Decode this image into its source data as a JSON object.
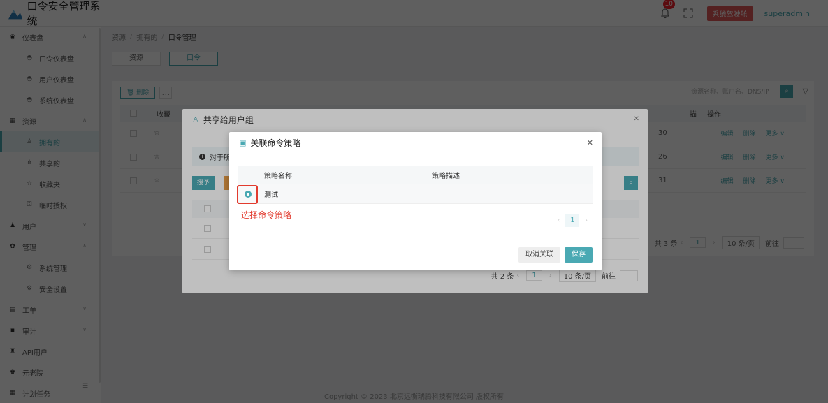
{
  "app": {
    "title": "口令安全管理系统"
  },
  "header": {
    "notification_count": "10",
    "system_button": "系统驾驶舱",
    "user_name": "superadmin"
  },
  "sidebar": {
    "groups": [
      {
        "label": "仪表盘",
        "icon": "dashboard-icon"
      },
      {
        "label": "资源",
        "icon": "grid-icon"
      },
      {
        "label": "用户",
        "icon": "user-icon"
      },
      {
        "label": "管理",
        "icon": "gear-icon"
      },
      {
        "label": "工单",
        "icon": "ticket-icon"
      },
      {
        "label": "审计",
        "icon": "audit-icon"
      },
      {
        "label": "API用户",
        "icon": "api-icon"
      },
      {
        "label": "元老院",
        "icon": "crown-icon"
      },
      {
        "label": "计划任务",
        "icon": "calendar-icon"
      }
    ],
    "subitems": {
      "dashboard": [
        "口令仪表盘",
        "用户仪表盘",
        "系统仪表盘"
      ],
      "resource": [
        "拥有的",
        "共享的",
        "收藏夹",
        "临时授权"
      ],
      "manage": [
        "系统管理",
        "安全设置"
      ]
    }
  },
  "breadcrumb": [
    "资源",
    "拥有的",
    "口令管理"
  ],
  "tabs": [
    "资源",
    "口令"
  ],
  "main": {
    "delete_label": "删除",
    "search_placeholder": "资源名称、账户名、DNS/IP",
    "columns": [
      "收藏",
      "操作"
    ],
    "col_partial": "描",
    "row_values": [
      "30",
      "26",
      "31"
    ],
    "ops": [
      "编辑",
      "删除",
      "更多 ∨"
    ],
    "pager": {
      "total": "共 3 条",
      "page": "1",
      "size": "10 条/页",
      "goto": "前往"
    }
  },
  "share_dialog": {
    "title": "共享给用户组",
    "info_text": "对于所",
    "grant_label": "授予",
    "pager": {
      "total": "共 2 条",
      "page": "1",
      "size": "10 条/页",
      "goto": "前往"
    }
  },
  "policy_dialog": {
    "title": "关联命令策略",
    "columns": [
      "策略名称",
      "策略描述"
    ],
    "rows": [
      {
        "name": "测试",
        "desc": ""
      }
    ],
    "annotation": "选择命令策略",
    "page": "1",
    "cancel_label": "取消关联",
    "save_label": "保存"
  },
  "footer": {
    "copyright": "Copyright © 2023 北京远衡瑞腾科技有限公司 版权所有"
  },
  "colors": {
    "accent": "#4aa9b3",
    "highlight": "#e23b2e",
    "badge": "#f5222d"
  }
}
